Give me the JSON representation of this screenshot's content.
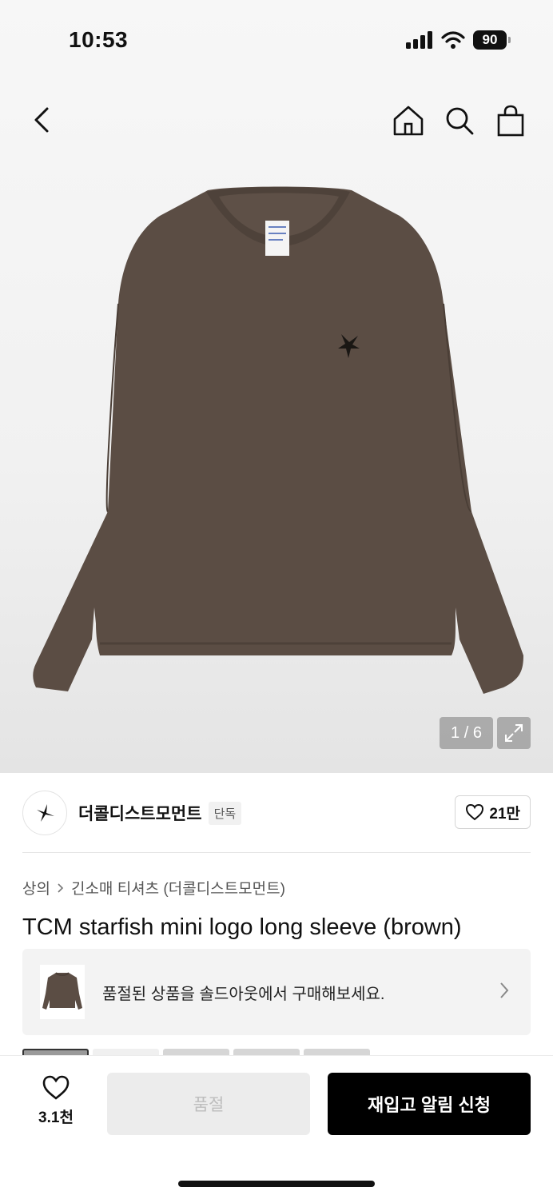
{
  "status": {
    "time": "10:53",
    "battery": "90"
  },
  "nav": {
    "back": "back-icon",
    "home": "home-icon",
    "search": "search-icon",
    "bag": "bag-icon"
  },
  "gallery": {
    "counter": "1 / 6"
  },
  "brand": {
    "name": "더콜디스트모먼트",
    "badge": "단독",
    "likes": "21만"
  },
  "breadcrumb": {
    "category": "상의",
    "subcategory": "긴소매 티셔츠 (더콜디스트모먼트)"
  },
  "product": {
    "title": "TCM starfish mini logo long sleeve (brown)"
  },
  "soldout_banner": {
    "text": "품절된 상품을 솔드아웃에서 구매해보세요."
  },
  "bottom": {
    "wish_count": "3.1천",
    "soldout_label": "품절",
    "restock_label": "재입고 알림 신청"
  },
  "colors": {
    "shirt": "#5b4d44",
    "shirt_dark": "#4e423a",
    "accent": "#000000"
  }
}
